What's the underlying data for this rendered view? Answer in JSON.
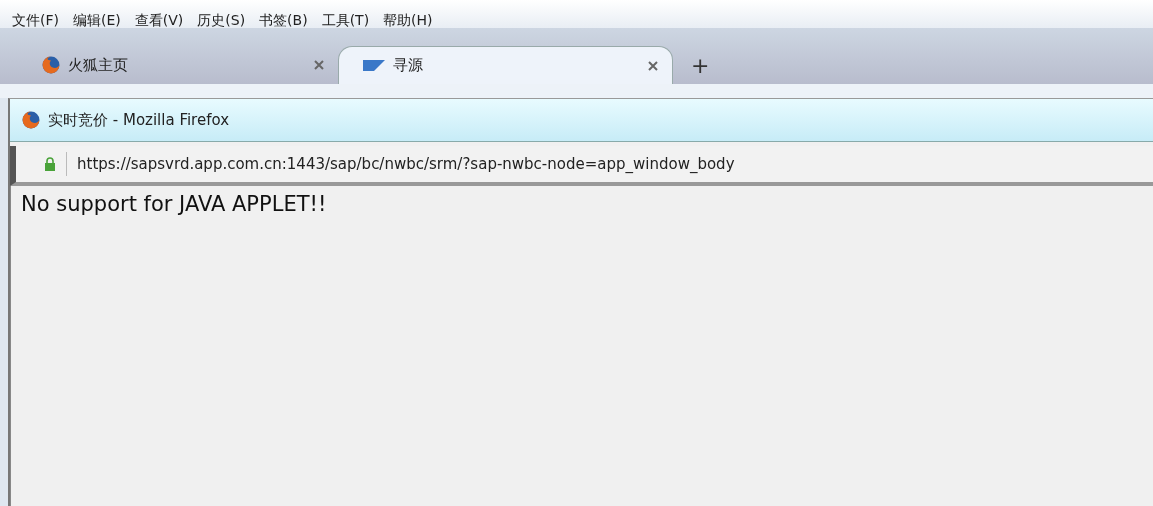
{
  "menu_bar": [
    "文件(F)",
    "编辑(E)",
    "查看(V)",
    "历史(S)",
    "书签(B)",
    "工具(T)",
    "帮助(H)"
  ],
  "tabs": [
    {
      "label": "火狐主页",
      "kind": "firefox",
      "selected": false
    },
    {
      "label": "寻源",
      "kind": "sap",
      "selected": true
    }
  ],
  "new_tab": "+",
  "popup": {
    "title": "实时竞价 - Mozilla Firefox",
    "url": "https://sapsvrd.app.com.cn:1443/sap/bc/nwbc/srm/?sap-nwbc-node=app_window_body",
    "secure": true,
    "content": "No support for JAVA APPLET!!"
  }
}
